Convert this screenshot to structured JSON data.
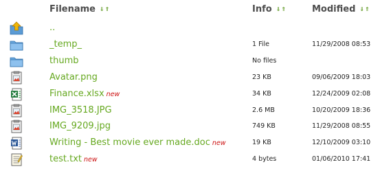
{
  "header": {
    "filename": "Filename",
    "info": "Info",
    "modified": "Modified",
    "sort_down": "⇓",
    "sort_up": "⇑"
  },
  "new_label": "new",
  "colors": {
    "link": "#65a81f",
    "new_tag": "#cc1111",
    "header": "#4d4d4d",
    "folder": "#5b9bd5",
    "parent_arrow": "#f2b705"
  },
  "rows": [
    {
      "name": "..",
      "info": "",
      "modified": "",
      "is_new": false,
      "icon": "parent-folder-icon"
    },
    {
      "name": "_temp_",
      "info": "1 File",
      "modified": "11/29/2008 08:53",
      "is_new": false,
      "icon": "folder-icon"
    },
    {
      "name": "thumb",
      "info": "No files",
      "modified": "",
      "is_new": false,
      "icon": "folder-icon"
    },
    {
      "name": "Avatar.png",
      "info": "23 KB",
      "modified": "09/06/2009 18:03",
      "is_new": false,
      "icon": "image-file-icon"
    },
    {
      "name": "Finance.xlsx",
      "info": "34 KB",
      "modified": "12/24/2009 02:08",
      "is_new": true,
      "icon": "excel-file-icon"
    },
    {
      "name": "IMG_3518.JPG",
      "info": "2.6 MB",
      "modified": "10/20/2009 18:36",
      "is_new": false,
      "icon": "image-file-icon"
    },
    {
      "name": "IMG_9209.jpg",
      "info": "749 KB",
      "modified": "11/29/2008 08:55",
      "is_new": false,
      "icon": "image-file-icon"
    },
    {
      "name": "Writing - Best movie ever made.doc",
      "info": "19 KB",
      "modified": "12/10/2009 03:10",
      "is_new": true,
      "icon": "word-file-icon"
    },
    {
      "name": "test.txt",
      "info": "4 bytes",
      "modified": "01/06/2010 17:41",
      "is_new": true,
      "icon": "text-file-icon"
    }
  ]
}
